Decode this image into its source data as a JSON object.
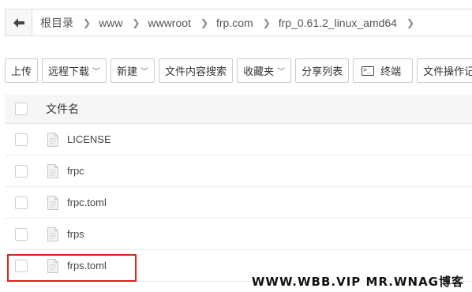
{
  "breadcrumb": {
    "back_icon": "arrow-left-icon",
    "items": [
      {
        "label": "根目录"
      },
      {
        "label": "www"
      },
      {
        "label": "wwwroot"
      },
      {
        "label": "frp.com"
      },
      {
        "label": "frp_0.61.2_linux_amd64"
      }
    ]
  },
  "toolbar": {
    "upload": "上传",
    "remote_download": "远程下载",
    "new": "新建",
    "content_search": "文件内容搜索",
    "favorites": "收藏夹",
    "share_list": "分享列表",
    "terminal": "终端",
    "operation_log": "文件操作记录",
    "terminal_icon": "terminal-icon",
    "dropdown_icon": "chevron-down-icon"
  },
  "table": {
    "header_name": "文件名",
    "files": [
      {
        "name": "LICENSE"
      },
      {
        "name": "frpc"
      },
      {
        "name": "frpc.toml"
      },
      {
        "name": "frps"
      },
      {
        "name": "frps.toml"
      }
    ],
    "file_icon": "file-icon"
  },
  "highlight_color": "#d9221c",
  "watermark": "WWW.WBB.VIP   MR.WNAG博客"
}
